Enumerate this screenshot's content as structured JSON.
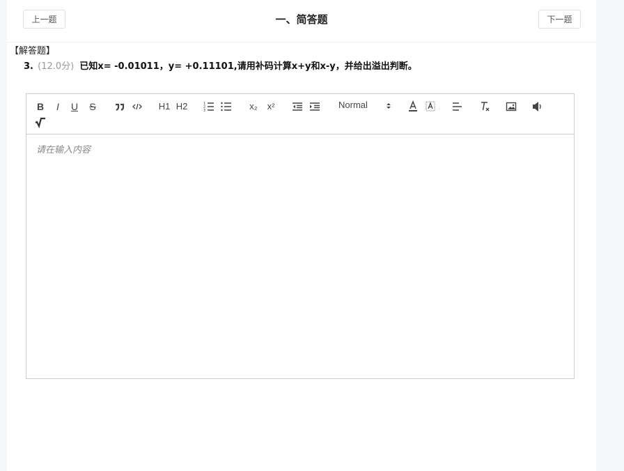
{
  "header": {
    "prev_label": "上一题",
    "next_label": "下一题",
    "title": "一、简答题"
  },
  "question": {
    "type_label": "【解答题】",
    "number": "3.",
    "score": "(12.0分)",
    "text": "已知x= -0.01011，y= +0.11101,请用补码计算x+y和x-y，并给出溢出判断。"
  },
  "editor": {
    "placeholder": "请在输入内容",
    "toolbar": {
      "bold": "B",
      "italic": "I",
      "underline": "U",
      "strike": "S",
      "h1": "H1",
      "h2": "H2",
      "header_select": "Normal",
      "subscript": "x₂",
      "superscript": "x²"
    }
  }
}
